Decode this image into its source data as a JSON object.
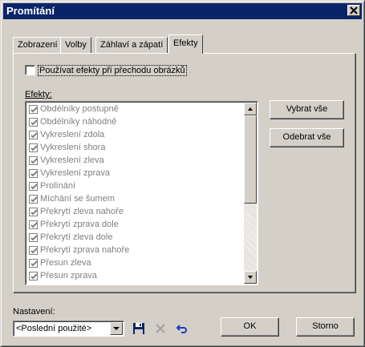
{
  "window": {
    "title": "Promítání",
    "close_label": "✕"
  },
  "tabs": [
    {
      "label": "Zobrazení"
    },
    {
      "label": "Volby"
    },
    {
      "label": "Záhlaví a zápatí"
    },
    {
      "label": "Efekty",
      "active": true
    }
  ],
  "effects_tab": {
    "use_effects_label": "Používat efekty při přechodu obrázků",
    "use_effects_checked": false,
    "list_label": "Efekty:",
    "items": [
      {
        "label": "Obdélníky postupně",
        "checked": true
      },
      {
        "label": "Obdélníky náhodně",
        "checked": true
      },
      {
        "label": "Vykreslení zdola",
        "checked": true
      },
      {
        "label": "Vykreslení shora",
        "checked": true
      },
      {
        "label": "Vykreslení zleva",
        "checked": true
      },
      {
        "label": "Vykreslení zprava",
        "checked": true
      },
      {
        "label": "Prolínání",
        "checked": true
      },
      {
        "label": "Míchání se šumem",
        "checked": true
      },
      {
        "label": "Překrytí zleva nahoře",
        "checked": true
      },
      {
        "label": "Překrytí zprava dole",
        "checked": true
      },
      {
        "label": "Překrytí zleva dole",
        "checked": true
      },
      {
        "label": "Překrytí zprava nahoře",
        "checked": true
      },
      {
        "label": "Přesun zleva",
        "checked": true
      },
      {
        "label": "Přesun zprava",
        "checked": true
      }
    ],
    "select_all_label": "Vybrat vše",
    "deselect_all_label": "Odebrat vše"
  },
  "footer": {
    "settings_label": "Nastavení:",
    "settings_value": "<Poslední použité>",
    "ok_label": "OK",
    "cancel_label": "Storno"
  },
  "colors": {
    "title_bar": "#0a246a",
    "face": "#d4d0c8",
    "disabled_text": "#808080"
  }
}
